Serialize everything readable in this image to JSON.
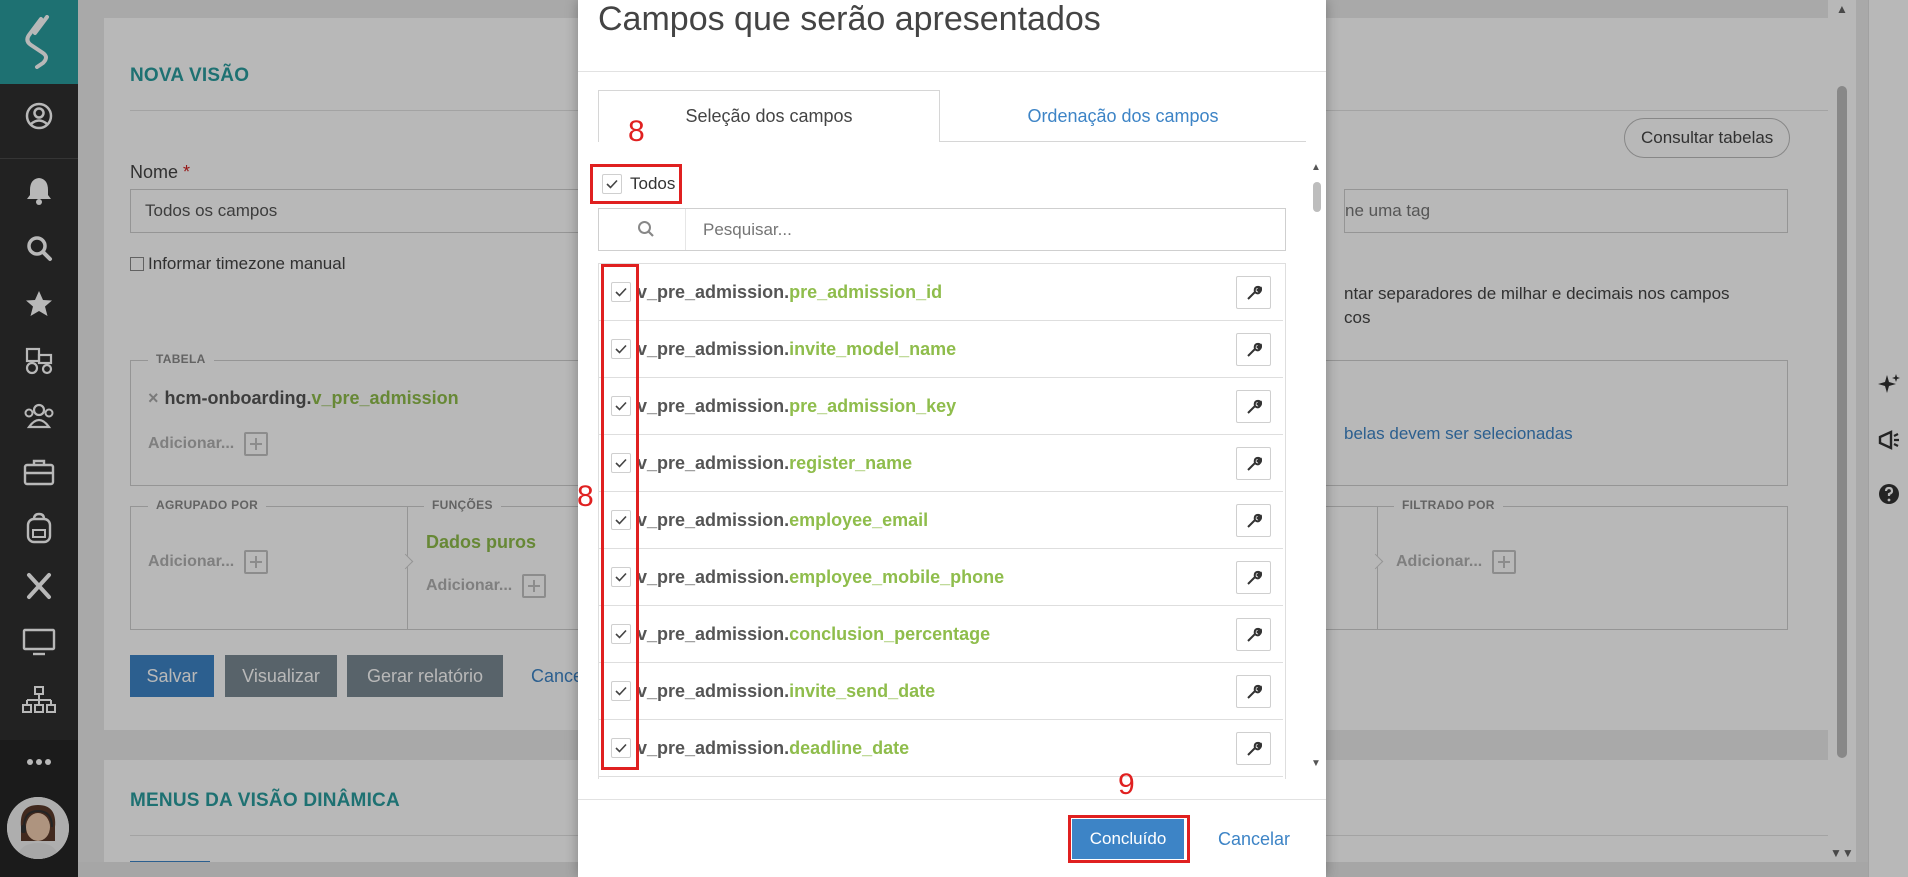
{
  "page": {
    "nova_visao_title": "NOVA VISÃO",
    "consultar_tabelas": "Consultar tabelas",
    "nome_label": "Nome",
    "nome_required": "*",
    "nome_value": "Todos os campos",
    "tag_placeholder": "ne uma tag",
    "timezone_label": "Informar timezone manual",
    "separadores_line1": "ntar separadores de milhar e decimais nos campos",
    "separadores_line2": "cos",
    "tabela_label": "TABELA",
    "tabela_schema": "hcm-onboarding.",
    "tabela_name": "v_pre_admission",
    "tabela_remove": "×",
    "adicionar": "Adicionar...",
    "tabelas_hint": "belas devem ser selecionadas",
    "agrupado_label": "AGRUPADO POR",
    "funcoes_label": "FUNÇÕES",
    "dados_puros": "Dados puros",
    "filtrado_label": "FILTRADO POR",
    "btn_salvar": "Salvar",
    "btn_visualizar": "Visualizar",
    "btn_gerar": "Gerar relatório",
    "btn_cancelar_link": "Cance",
    "menus_title": "MENUS DA VISÃO DINÂMICA"
  },
  "modal": {
    "title": "Campos que serão apresentados",
    "tabs": [
      {
        "label": "Seleção dos campos",
        "active": true
      },
      {
        "label": "Ordenação dos campos",
        "active": false
      }
    ],
    "todos_label": "Todos",
    "search_placeholder": "Pesquisar...",
    "table_prefix": "v_pre_admission.",
    "fields": [
      "pre_admission_id",
      "invite_model_name",
      "pre_admission_key",
      "register_name",
      "employee_email",
      "employee_mobile_phone",
      "conclusion_percentage",
      "invite_send_date",
      "deadline_date"
    ],
    "btn_concluido": "Concluído",
    "btn_cancelar": "Cancelar"
  },
  "annotations": {
    "step_8_top": "8",
    "step_8_side": "8",
    "step_9": "9"
  },
  "colors": {
    "teal": "#2a9d9e",
    "green": "#8fbd4c",
    "blue": "#3d84c6",
    "annotation_red": "#e02020"
  }
}
